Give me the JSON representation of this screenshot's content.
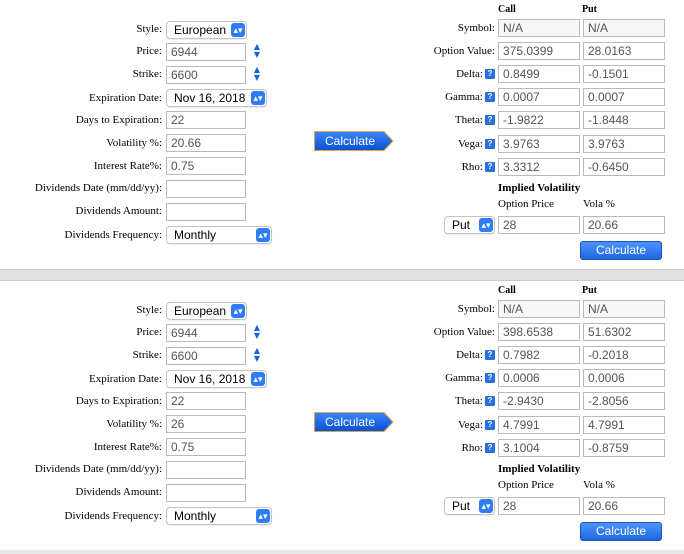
{
  "labels": {
    "style": "Style:",
    "price": "Price:",
    "strike": "Strike:",
    "expiration": "Expiration Date:",
    "days": "Days to Expiration:",
    "volatility": "Volatility %:",
    "interest": "Interest Rate%:",
    "div_date": "Dividends Date (mm/dd/yy):",
    "div_amount": "Dividends Amount:",
    "div_freq": "Dividends Frequency:",
    "call": "Call",
    "put": "Put",
    "symbol": "Symbol:",
    "option_value": "Option Value:",
    "delta": "Delta:",
    "gamma": "Gamma:",
    "theta": "Theta:",
    "vega": "Vega:",
    "rho": "Rho:",
    "implied_vol": "Implied Volatility",
    "option_price": "Option Price",
    "vola_pct": "Vola %",
    "calculate": "Calculate",
    "help": "?"
  },
  "panels": [
    {
      "inputs": {
        "style": "European",
        "price": "6944",
        "strike": "6600",
        "expiration": "Nov 16, 2018",
        "days": "22",
        "volatility": "20.66",
        "interest": "0.75",
        "div_date": "",
        "div_amount": "",
        "div_freq": "Monthly"
      },
      "results": {
        "symbol": {
          "call": "N/A",
          "put": "N/A"
        },
        "option_value": {
          "call": "375.0399",
          "put": "28.0163"
        },
        "delta": {
          "call": "0.8499",
          "put": "-0.1501"
        },
        "gamma": {
          "call": "0.0007",
          "put": "0.0007"
        },
        "theta": {
          "call": "-1.9822",
          "put": "-1.8448"
        },
        "vega": {
          "call": "3.9763",
          "put": "3.9763"
        },
        "rho": {
          "call": "3.3312",
          "put": "-0.6450"
        }
      },
      "iv": {
        "type": "Put",
        "option_price": "28",
        "vola": "20.66"
      }
    },
    {
      "inputs": {
        "style": "European",
        "price": "6944",
        "strike": "6600",
        "expiration": "Nov 16, 2018",
        "days": "22",
        "volatility": "26",
        "interest": "0.75",
        "div_date": "",
        "div_amount": "",
        "div_freq": "Monthly"
      },
      "results": {
        "symbol": {
          "call": "N/A",
          "put": "N/A"
        },
        "option_value": {
          "call": "398.6538",
          "put": "51.6302"
        },
        "delta": {
          "call": "0.7982",
          "put": "-0.2018"
        },
        "gamma": {
          "call": "0.0006",
          "put": "0.0006"
        },
        "theta": {
          "call": "-2.9430",
          "put": "-2.8056"
        },
        "vega": {
          "call": "4.7991",
          "put": "4.7991"
        },
        "rho": {
          "call": "3.1004",
          "put": "-0.8759"
        }
      },
      "iv": {
        "type": "Put",
        "option_price": "28",
        "vola": "20.66"
      }
    }
  ]
}
